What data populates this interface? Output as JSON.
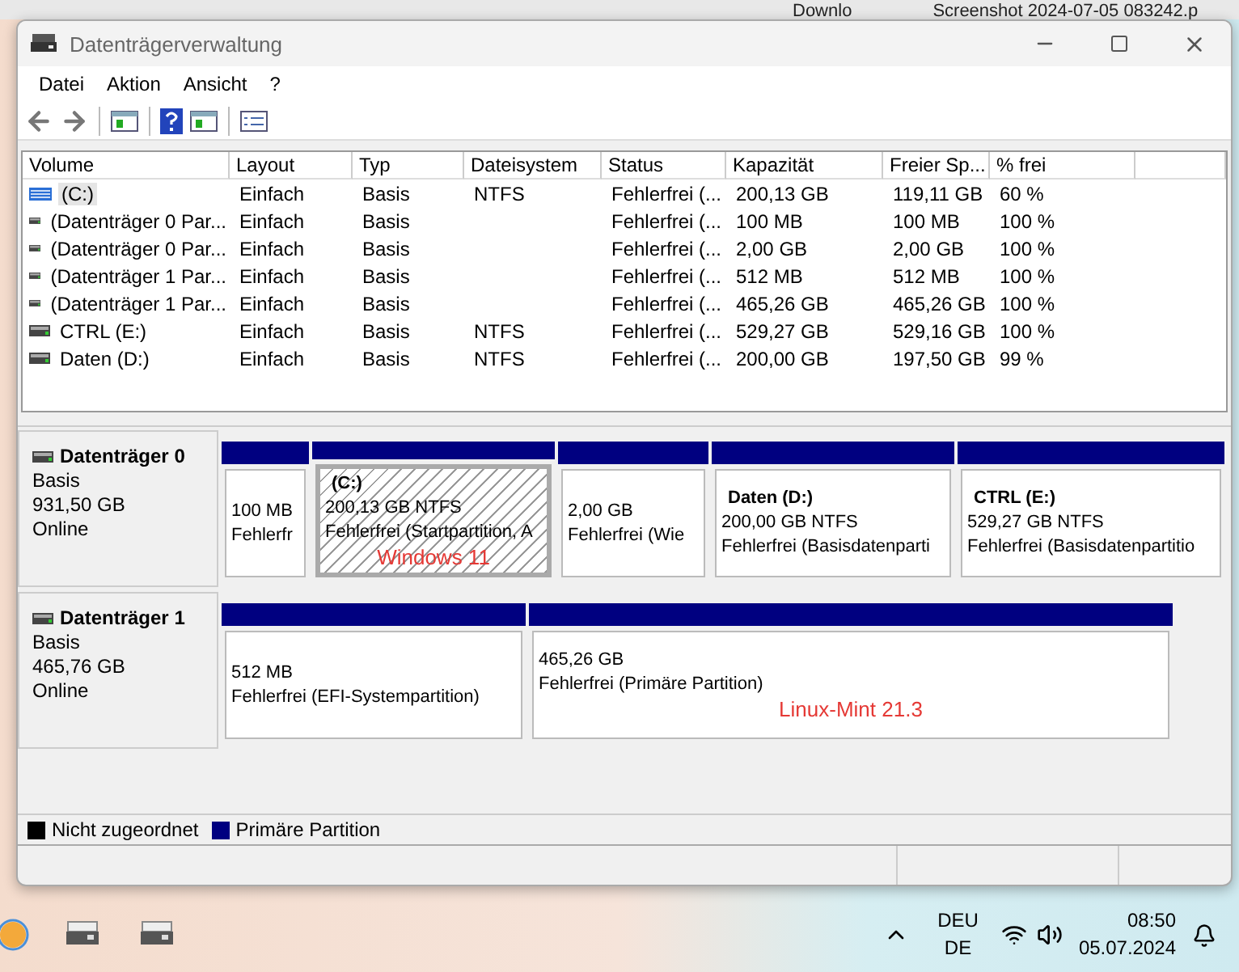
{
  "background_windows": [
    {
      "text": "Downlo"
    },
    {
      "text": "Screenshot 2024-07-05 083242.p"
    }
  ],
  "window": {
    "title": "Datenträgerverwaltung"
  },
  "menu": [
    "Datei",
    "Aktion",
    "Ansicht",
    "?"
  ],
  "table": {
    "columns": [
      "Volume",
      "Layout",
      "Typ",
      "Dateisystem",
      "Status",
      "Kapazität",
      "Freier Sp...",
      "% frei"
    ],
    "rows": [
      {
        "kind": "striped",
        "selected": true,
        "cells": [
          "(C:)",
          "Einfach",
          "Basis",
          "NTFS",
          "Fehlerfrei (...",
          "200,13 GB",
          "119,11 GB",
          "60 %"
        ]
      },
      {
        "kind": "plain",
        "selected": false,
        "cells": [
          "(Datenträger 0 Par...",
          "Einfach",
          "Basis",
          "",
          "Fehlerfrei (...",
          "100 MB",
          "100 MB",
          "100 %"
        ]
      },
      {
        "kind": "plain",
        "selected": false,
        "cells": [
          "(Datenträger 0 Par...",
          "Einfach",
          "Basis",
          "",
          "Fehlerfrei (...",
          "2,00 GB",
          "2,00 GB",
          "100 %"
        ]
      },
      {
        "kind": "plain",
        "selected": false,
        "cells": [
          "(Datenträger 1 Par...",
          "Einfach",
          "Basis",
          "",
          "Fehlerfrei (...",
          "512 MB",
          "512 MB",
          "100 %"
        ]
      },
      {
        "kind": "plain",
        "selected": false,
        "cells": [
          "(Datenträger 1 Par...",
          "Einfach",
          "Basis",
          "",
          "Fehlerfrei (...",
          "465,26 GB",
          "465,26 GB",
          "100 %"
        ]
      },
      {
        "kind": "plain",
        "selected": false,
        "cells": [
          "CTRL (E:)",
          "Einfach",
          "Basis",
          "NTFS",
          "Fehlerfrei (...",
          "529,27 GB",
          "529,16 GB",
          "100 %"
        ]
      },
      {
        "kind": "plain",
        "selected": false,
        "cells": [
          "Daten (D:)",
          "Einfach",
          "Basis",
          "NTFS",
          "Fehlerfrei (...",
          "200,00 GB",
          "197,50 GB",
          "99 %"
        ]
      }
    ]
  },
  "disks": [
    {
      "name": "Datenträger 0",
      "type": "Basis",
      "size": "931,50 GB",
      "state": "Online",
      "partitions": [
        {
          "selected": false,
          "size": "100 MB",
          "status": "Fehlerfr"
        },
        {
          "selected": true,
          "name": "(C:)",
          "size": "200,13 GB NTFS",
          "status": "Fehlerfrei (Startpartition, A",
          "note": "Windows 11"
        },
        {
          "selected": false,
          "size": "2,00 GB",
          "status": "Fehlerfrei (Wie"
        },
        {
          "selected": false,
          "name": "Daten  (D:)",
          "size": "200,00 GB NTFS",
          "status": "Fehlerfrei (Basisdatenparti"
        },
        {
          "selected": false,
          "name": "CTRL  (E:)",
          "size": "529,27 GB NTFS",
          "status": "Fehlerfrei (Basisdatenpartitio"
        }
      ]
    },
    {
      "name": "Datenträger 1",
      "type": "Basis",
      "size": "465,76 GB",
      "state": "Online",
      "partitions": [
        {
          "selected": false,
          "size": "512 MB",
          "status": "Fehlerfrei (EFI-Systempartition)"
        },
        {
          "selected": false,
          "size": "465,26 GB",
          "status": "Fehlerfrei (Primäre Partition)",
          "note": "Linux-Mint 21.3"
        }
      ]
    }
  ],
  "legend": [
    {
      "label": "Nicht zugeordnet",
      "color": "#000000"
    },
    {
      "label": "Primäre Partition",
      "color": "#000080"
    }
  ],
  "taskbar": {
    "language": "DEU",
    "layout": "DE",
    "time": "08:50",
    "date": "05.07.2024"
  }
}
